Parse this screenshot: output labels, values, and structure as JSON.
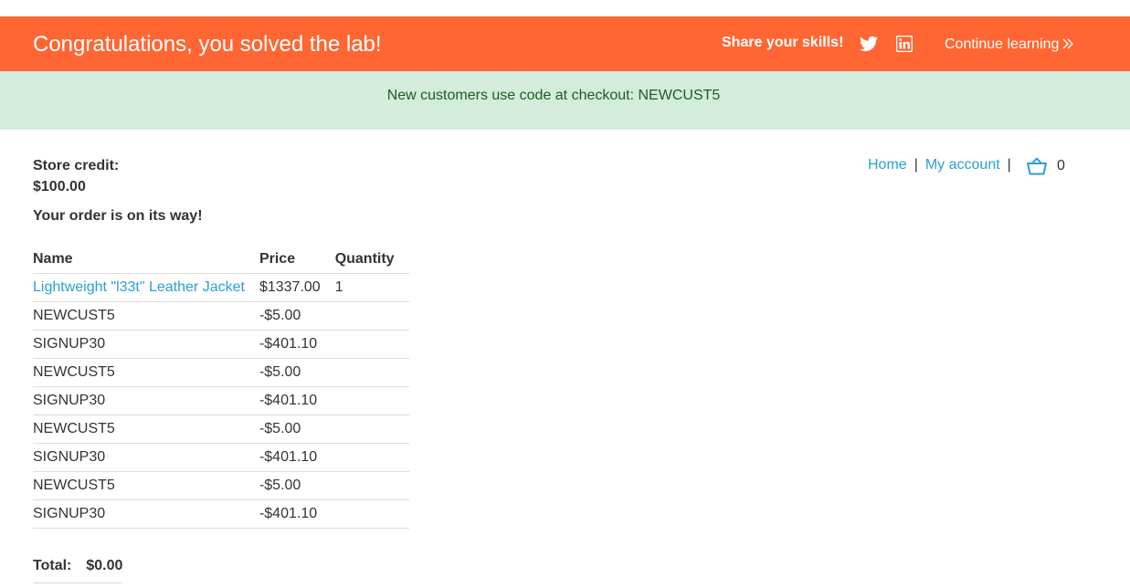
{
  "banner": {
    "title": "Congratulations, you solved the lab!",
    "share_label": "Share your skills!",
    "continue_label": "Continue learning",
    "background_color": "#ff6633"
  },
  "notice": {
    "text": "New customers use code at checkout: NEWCUST5",
    "background_color": "#d4ecdc"
  },
  "store_credit": {
    "label": "Store credit:",
    "value": "$100.00"
  },
  "order_message": "Your order is on its way!",
  "nav": {
    "home": "Home",
    "separator": "|",
    "my_account": "My account",
    "cart_count": "0",
    "link_color": "#2a9fd6"
  },
  "table": {
    "headers": {
      "name": "Name",
      "price": "Price",
      "quantity": "Quantity"
    },
    "product": {
      "name": "Lightweight \"l33t\" Leather Jacket",
      "price": "$1337.00",
      "quantity": "1"
    },
    "discounts": [
      {
        "name": "NEWCUST5",
        "price": "-$5.00"
      },
      {
        "name": "SIGNUP30",
        "price": "-$401.10"
      },
      {
        "name": "NEWCUST5",
        "price": "-$5.00"
      },
      {
        "name": "SIGNUP30",
        "price": "-$401.10"
      },
      {
        "name": "NEWCUST5",
        "price": "-$5.00"
      },
      {
        "name": "SIGNUP30",
        "price": "-$401.10"
      },
      {
        "name": "NEWCUST5",
        "price": "-$5.00"
      },
      {
        "name": "SIGNUP30",
        "price": "-$401.10"
      }
    ]
  },
  "total": {
    "label": "Total:",
    "value": "$0.00"
  },
  "icons": {
    "twitter": "twitter-icon",
    "linkedin": "linkedin-icon",
    "chevron": "double-chevron-right-icon",
    "cart": "cart-basket-icon"
  }
}
